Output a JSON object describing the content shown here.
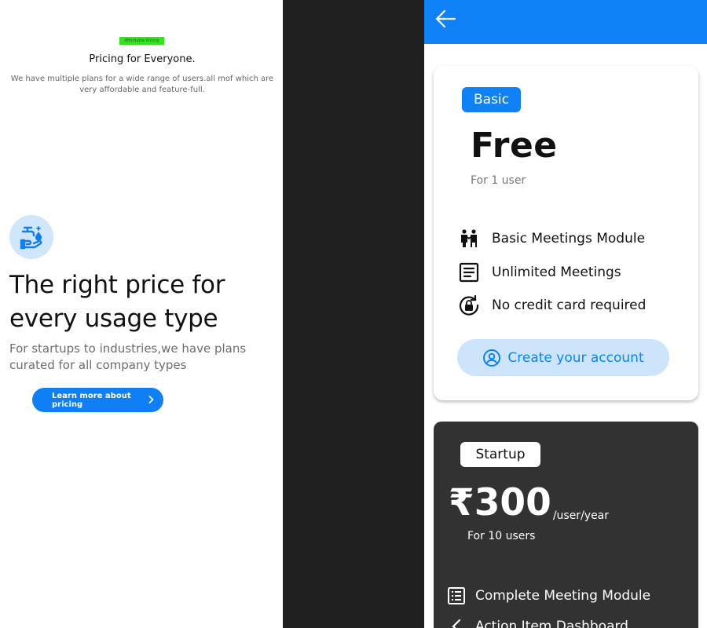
{
  "left": {
    "badge": "Affordable Pricing",
    "title": "Pricing for Everyone.",
    "subtitle": "We have multiple plans for a wide range of users.all mof which are very affordable and feature-full.",
    "heading": "The right price for every usage type",
    "description": "For startups to industries,we have plans curated for all company types",
    "cta_label": "Learn more about pricing",
    "icon": "hand-wash-icon"
  },
  "app_bar": {
    "back_icon": "arrow-left-icon",
    "color": "#0f82f8"
  },
  "basic_plan": {
    "tag": "Basic",
    "price": "Free",
    "users": "For 1 user",
    "features": [
      {
        "icon": "people-icon",
        "label": "Basic Meetings Module"
      },
      {
        "icon": "notes-icon",
        "label": "Unlimited Meetings"
      },
      {
        "icon": "lock-reset-icon",
        "label": "No credit card required"
      }
    ],
    "cta_label": "Create your account",
    "cta_icon": "account-circle-icon"
  },
  "startup_plan": {
    "tag": "Startup",
    "price": "₹300",
    "period": "/user/year",
    "users": "For 10 users",
    "features": [
      {
        "icon": "list-icon",
        "label": "Complete Meeting Module"
      },
      {
        "icon": "chevron-icon",
        "label": "Action Item Dashboard"
      }
    ]
  },
  "colors": {
    "accent": "#0f82f8",
    "badge_green": "#33e31e",
    "dark_card": "#323232",
    "gap": "#1f1f1f"
  }
}
